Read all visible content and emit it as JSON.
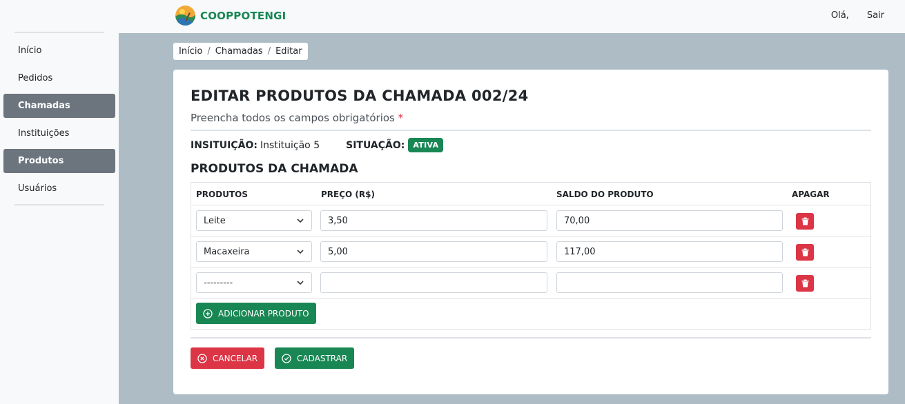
{
  "brand": {
    "name": "COOPPOTENGI"
  },
  "topnav": {
    "hello": "Olá,",
    "logout": "Sair"
  },
  "sidebar": {
    "items": [
      {
        "label": "Início"
      },
      {
        "label": "Pedidos"
      },
      {
        "label": "Chamadas"
      },
      {
        "label": "Instituições"
      },
      {
        "label": "Produtos"
      },
      {
        "label": "Usuários"
      }
    ]
  },
  "breadcrumb": {
    "home": "Início",
    "section": "Chamadas",
    "current": "Editar"
  },
  "page": {
    "title": "EDITAR PRODUTOS DA CHAMADA 002/24",
    "subtitle": "Preencha todos os campos obrigatórios",
    "required_mark": "*",
    "institution_label": "INSITUIÇÃO:",
    "institution_value": "Instituição 5",
    "status_label": "SITUAÇÃO:",
    "status_value": "ATIVA",
    "section_title": "PRODUTOS DA CHAMADA"
  },
  "table": {
    "headers": {
      "product": "PRODUTOS",
      "price": "PREÇO (R$)",
      "balance": "SALDO DO PRODUTO",
      "delete": "APAGAR"
    },
    "rows": [
      {
        "product": "Leite",
        "price": "3,50",
        "balance": "70,00"
      },
      {
        "product": "Macaxeira",
        "price": "5,00",
        "balance": "117,00"
      },
      {
        "product": "---------",
        "price": "",
        "balance": ""
      }
    ],
    "add_label": "ADICIONAR PRODUTO"
  },
  "actions": {
    "cancel": "CANCELAR",
    "save": "CADASTRAR"
  },
  "colors": {
    "primary": "#198754",
    "danger": "#dc3545",
    "sidebar_active": "#6c757d",
    "main_bg": "#adbcc5"
  },
  "icons": {
    "logo": "cooperative-logo-icon",
    "chevron": "chevron-down-icon",
    "trash": "trash-icon",
    "add": "plus-circle-icon",
    "cancel": "x-circle-icon",
    "save": "check-circle-icon"
  }
}
